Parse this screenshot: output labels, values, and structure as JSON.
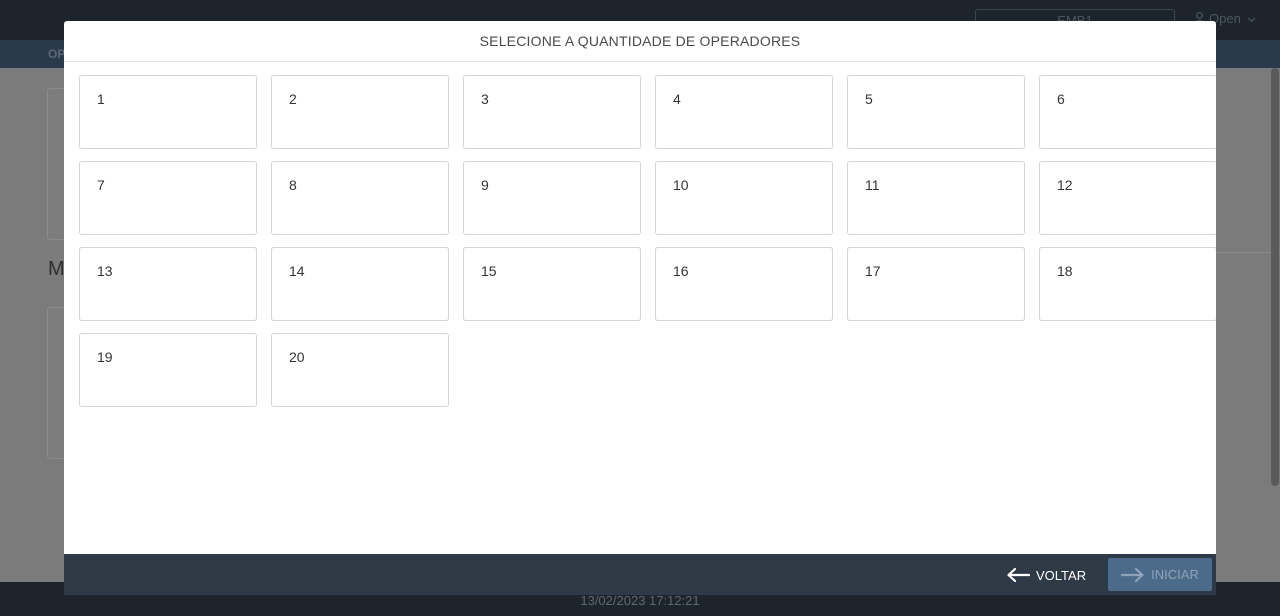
{
  "background": {
    "station_label": "EMB1",
    "user_label": "Open",
    "tab_label": "OP",
    "section_heading": "M",
    "datetime": "13/02/2023 17:12:21"
  },
  "modal": {
    "title": "SELECIONE A QUANTIDADE DE OPERADORES",
    "options": [
      "1",
      "2",
      "3",
      "4",
      "5",
      "6",
      "7",
      "8",
      "9",
      "10",
      "11",
      "12",
      "13",
      "14",
      "15",
      "16",
      "17",
      "18",
      "19",
      "20"
    ],
    "back_label": "VOLTAR",
    "start_label": "INICIAR"
  },
  "colors": {
    "footer": "#2f3a47",
    "start_button": "#4c6a8a",
    "overlay_dim": "#7b7b7b",
    "topbar": "#1d242c"
  },
  "icons": {
    "back": "arrow-left-icon",
    "start": "arrow-right-icon",
    "user": "user-icon",
    "dropdown": "chevron-down-icon"
  }
}
